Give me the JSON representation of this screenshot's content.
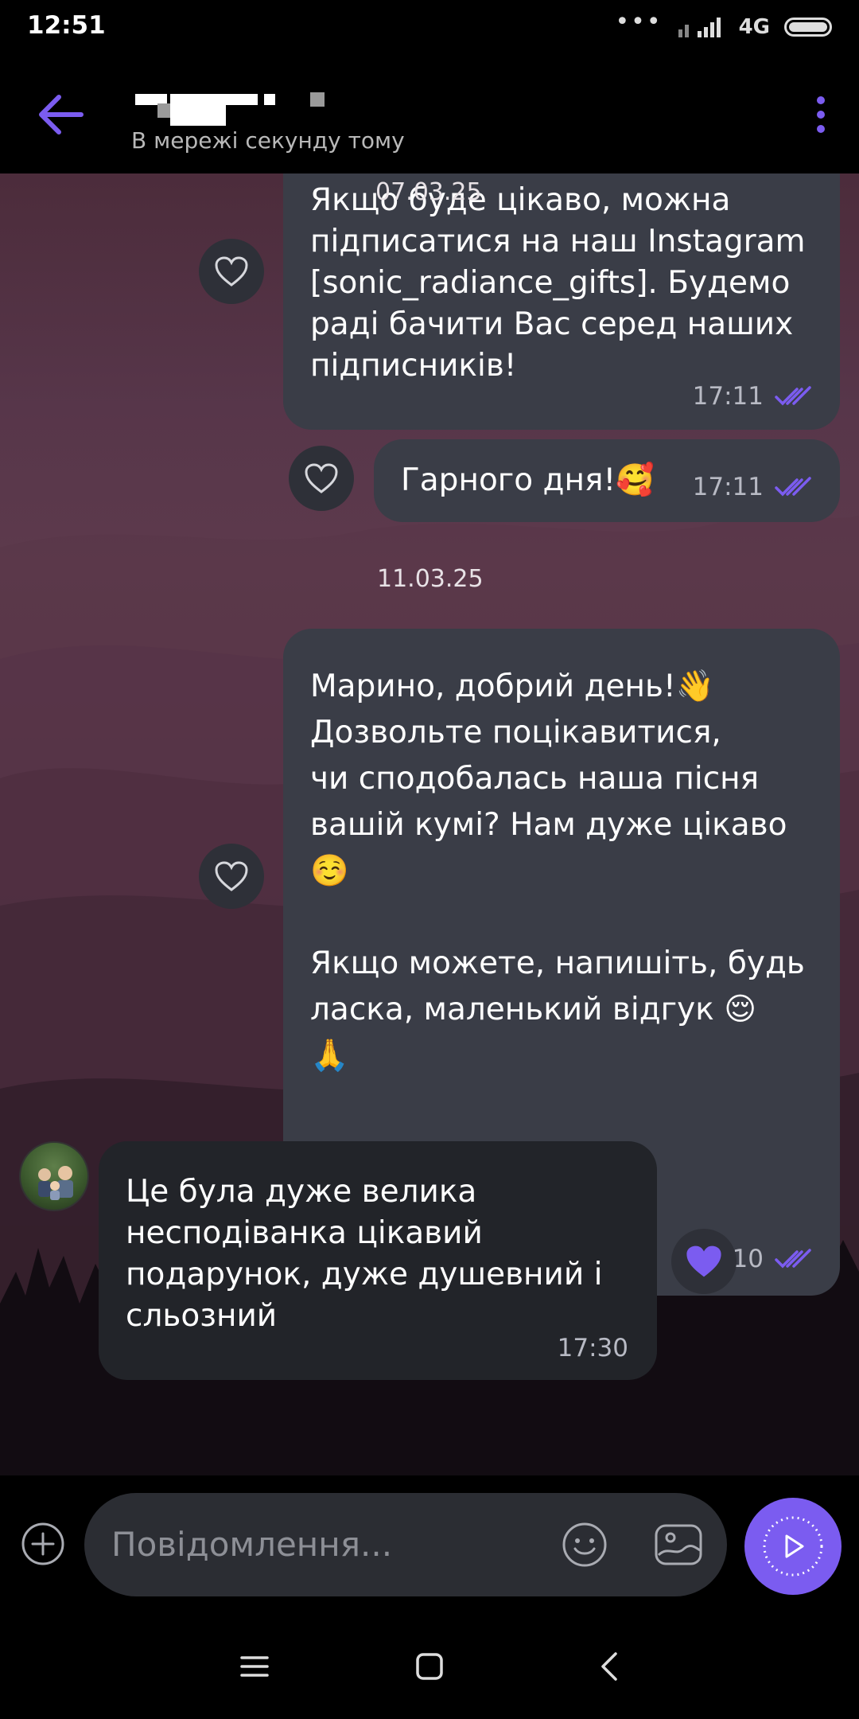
{
  "status_bar": {
    "time": "12:51",
    "network": "4G",
    "battery_icon": "battery-full-icon",
    "signal_icon": "signal-bars-icon"
  },
  "header": {
    "back_icon": "arrow-left-icon",
    "contact_name": "",
    "presence": "В мережі секунду тому",
    "menu_icon": "more-vertical-icon",
    "accent_color": "#7b5cf0"
  },
  "chat": {
    "date_separators": [
      "07.03.25",
      "11.03.25"
    ],
    "messages": [
      {
        "direction": "outgoing",
        "text": "Якщо буде цікаво, можна\nпідписатися на наш Instagram\n[sonic_radiance_gifts]. Будемо\nраді бачити Вас серед наших\nпідписників!",
        "time": "17:11",
        "status": "read"
      },
      {
        "direction": "outgoing",
        "text": "Гарного дня!🥰",
        "time": "17:11",
        "status": "read"
      },
      {
        "direction": "outgoing",
        "text": "Марино, добрий день!👋\nДозвольте поцікавитися,\nчи сподобалась наша пісня\nвашій кумі? Нам дуже цікаво\n☺️\n\nЯкщо можете, напишіть, будь\nласка, маленький відгук 😌\n🙏",
        "time": "17:10",
        "status": "read"
      },
      {
        "direction": "incoming",
        "text": "Це була дуже велика\nнесподіванка цікавий\nподарунок, дуже душевний і\nсльозний",
        "time": "17:30",
        "liked": true
      }
    ]
  },
  "composer": {
    "placeholder": "Повідомлення...",
    "plus_icon": "add-circle-icon",
    "emoji_icon": "smiley-icon",
    "gallery_icon": "gallery-icon",
    "send_icon": "voice-send-icon"
  },
  "navbar": {
    "menu_icon": "menu-lines-icon",
    "home_icon": "home-square-icon",
    "back_icon": "back-chevron-icon"
  },
  "colors": {
    "outgoing_bubble": "#3a3d47",
    "incoming_bubble": "#222429",
    "read_ticks": "#7b5cf0"
  }
}
